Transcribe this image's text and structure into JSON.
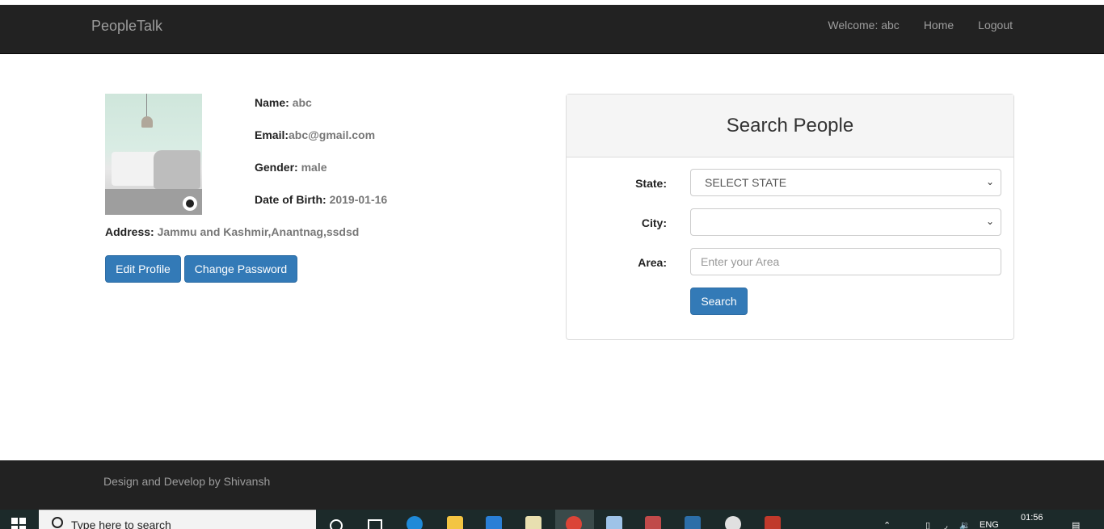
{
  "navbar": {
    "brand": "PeopleTalk",
    "welcome": "Welcome: abc",
    "home": "Home",
    "logout": "Logout"
  },
  "profile": {
    "name_label": "Name:",
    "name_value": "abc",
    "email_label": "Email:",
    "email_value": "abc@gmail.com",
    "gender_label": "Gender:",
    "gender_value": "male",
    "dob_label": "Date of Birth:",
    "dob_value": "2019-01-16",
    "address_label": "Address:",
    "address_value": "Jammu and Kashmir,Anantnag,ssdsd",
    "edit_button": "Edit Profile",
    "change_password_button": "Change Password"
  },
  "search_panel": {
    "title": "Search People",
    "state_label": "State:",
    "state_selected": "SELECT STATE",
    "city_label": "City:",
    "city_selected": "",
    "area_label": "Area:",
    "area_placeholder": "Enter your Area",
    "search_button": "Search"
  },
  "footer": {
    "text": "Design and Develop by Shivansh"
  },
  "taskbar": {
    "search_placeholder": "Type here to search",
    "language": "ENG",
    "time": "01:56"
  },
  "colors": {
    "navbar_bg": "#222222",
    "primary_button": "#337ab7",
    "taskbar_bg": "#1c2a2a"
  }
}
